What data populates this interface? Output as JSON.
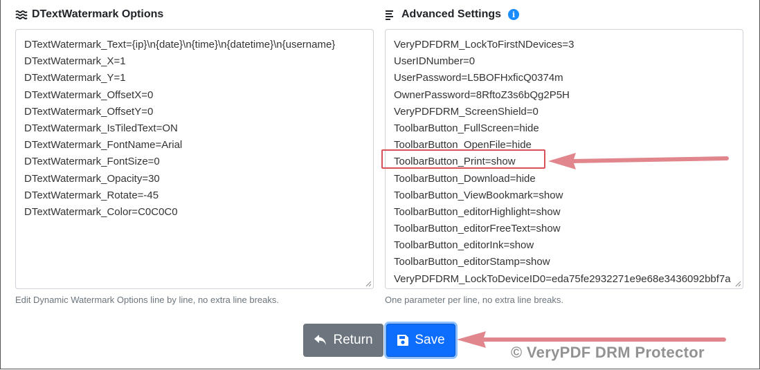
{
  "left_panel": {
    "title": "DTextWatermark Options",
    "icon": "water-waves-icon",
    "lines": [
      "DTextWatermark_Text={ip}\\n{date}\\n{time}\\n{datetime}\\n{username}",
      "DTextWatermark_X=1",
      "DTextWatermark_Y=1",
      "DTextWatermark_OffsetX=0",
      "DTextWatermark_OffsetY=0",
      "DTextWatermark_IsTiledText=ON",
      "DTextWatermark_FontName=Arial",
      "DTextWatermark_FontSize=0",
      "DTextWatermark_Opacity=30",
      "DTextWatermark_Rotate=-45",
      "DTextWatermark_Color=C0C0C0"
    ],
    "help": "Edit Dynamic Watermark Options line by line, no extra line breaks."
  },
  "right_panel": {
    "title": "Advanced Settings",
    "icon": "list-lines-icon",
    "info_icon": "i",
    "lines": [
      "VeryPDFDRM_LockToFirstNDevices=3",
      "UserIDNumber=0",
      "UserPassword=L5BOFHxficQ0374m",
      "OwnerPassword=8RftoZ3s6bQg2P5H",
      "VeryPDFDRM_ScreenShield=0",
      "ToolbarButton_FullScreen=hide",
      "ToolbarButton_OpenFile=hide",
      "ToolbarButton_Print=show",
      "ToolbarButton_Download=hide",
      "ToolbarButton_ViewBookmark=show",
      "ToolbarButton_editorHighlight=show",
      "ToolbarButton_editorFreeText=show",
      "ToolbarButton_editorInk=show",
      "ToolbarButton_editorStamp=show",
      "VeryPDFDRM_LockToDeviceID0=eda75fe2932271e9e68e3436092bbf7a"
    ],
    "help": "One parameter per line, no extra line breaks."
  },
  "buttons": {
    "return_label": "Return",
    "save_label": "Save"
  },
  "watermark": "© VeryPDF DRM Protector",
  "colors": {
    "save": "#0d6efd",
    "return": "#6c757d",
    "highlight": "#d9505a",
    "info": "#1a8cff"
  }
}
